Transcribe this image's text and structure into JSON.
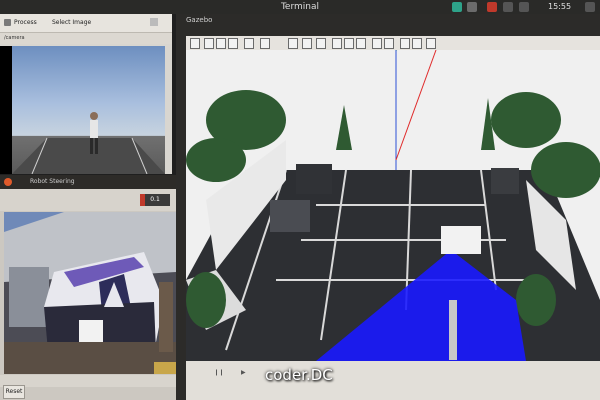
{
  "topbar": {
    "title": "Terminal",
    "clock": "15:55"
  },
  "image_view": {
    "title": "/camera",
    "toolbar_left": "Process",
    "toolbar_mid": "Select Image"
  },
  "rqt_window": {
    "title": "Robot Steering",
    "value": "0.1",
    "reset_label": "Reset"
  },
  "gazebo": {
    "title": "Gazebo",
    "watermark": "coder.DC"
  },
  "colors": {
    "laser_blue": "#1a1aff",
    "ground": "#2d2f33",
    "wall": "#eeeeee"
  }
}
